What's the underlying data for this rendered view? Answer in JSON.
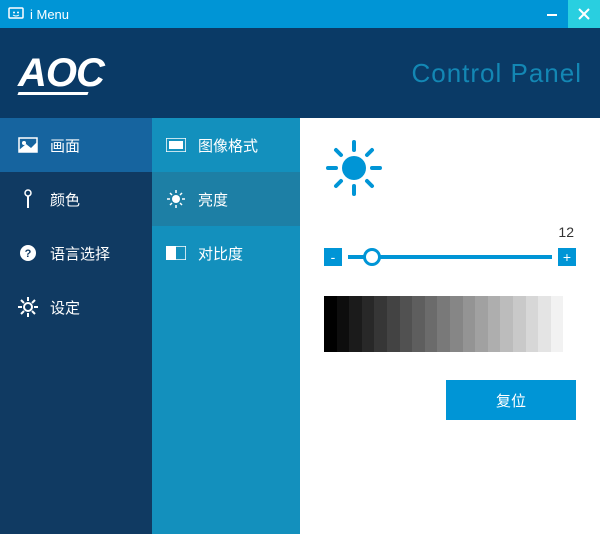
{
  "title": "i Menu",
  "header": {
    "logo": "AOC",
    "control_panel": "Control Panel"
  },
  "sidebar": {
    "items": [
      {
        "label": "画面"
      },
      {
        "label": "颜色"
      },
      {
        "label": "语言选择"
      },
      {
        "label": "设定"
      }
    ]
  },
  "subnav": {
    "items": [
      {
        "label": "图像格式"
      },
      {
        "label": "亮度"
      },
      {
        "label": "对比度"
      }
    ]
  },
  "main": {
    "value": "12",
    "minus": "-",
    "plus": "+",
    "reset": "复位"
  }
}
